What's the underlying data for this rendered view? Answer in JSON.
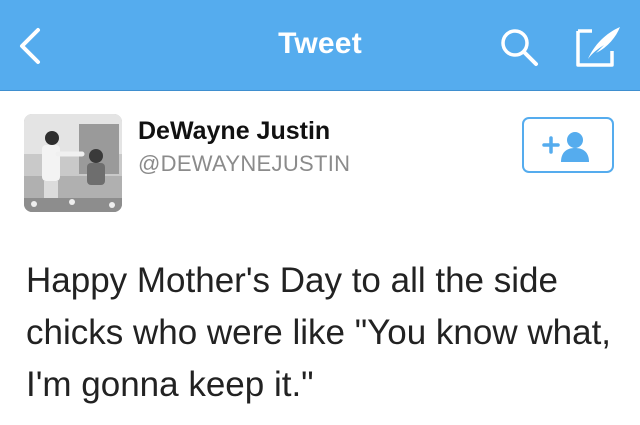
{
  "navbar": {
    "title": "Tweet",
    "back_icon": "chevron-left-icon",
    "search_icon": "search-icon",
    "compose_icon": "compose-feather-icon",
    "background_color": "#55acee",
    "foreground_color": "#ffffff"
  },
  "tweet": {
    "author": {
      "name": "DeWayne Justin",
      "handle": "@DEWAYNEJUSTIN",
      "avatar": "profile-photo"
    },
    "follow_button": {
      "icon": "add-user-icon",
      "color": "#55acee"
    },
    "text": "Happy Mother's Day to all the side chicks who were like \"You know what, I'm gonna keep it.\""
  }
}
